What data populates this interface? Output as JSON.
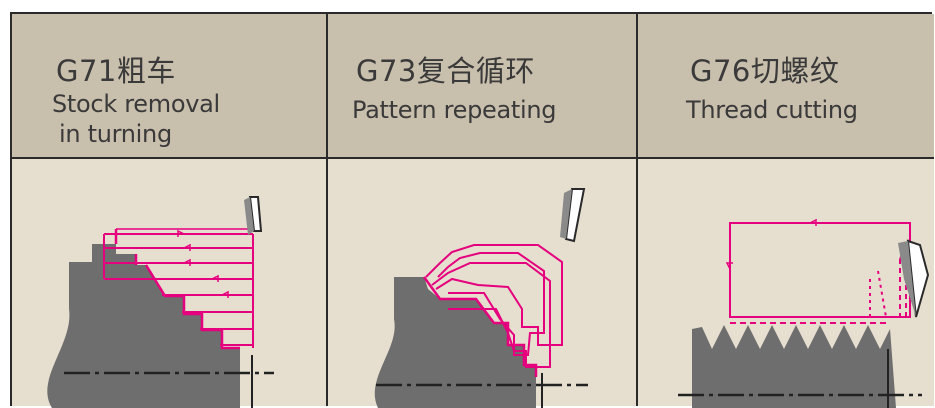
{
  "columns": [
    {
      "code": "G71粗车",
      "en_line1": "Stock removal",
      "en_line2": "in turning"
    },
    {
      "code": "G73复合循环",
      "en_line1": "Pattern repeating",
      "en_line2": ""
    },
    {
      "code": "G76切螺纹",
      "en_line1": "Thread cutting",
      "en_line2": ""
    }
  ],
  "colors": {
    "header_bg": "#c9bfad",
    "cell_bg": "#e6dfcf",
    "workpiece": "#6e6e6e",
    "toolpath": "#e5007e",
    "border": "#2a2a2a"
  },
  "icons": [
    "cutting-tool-icon",
    "workpiece-shape",
    "tool-path-lines"
  ]
}
